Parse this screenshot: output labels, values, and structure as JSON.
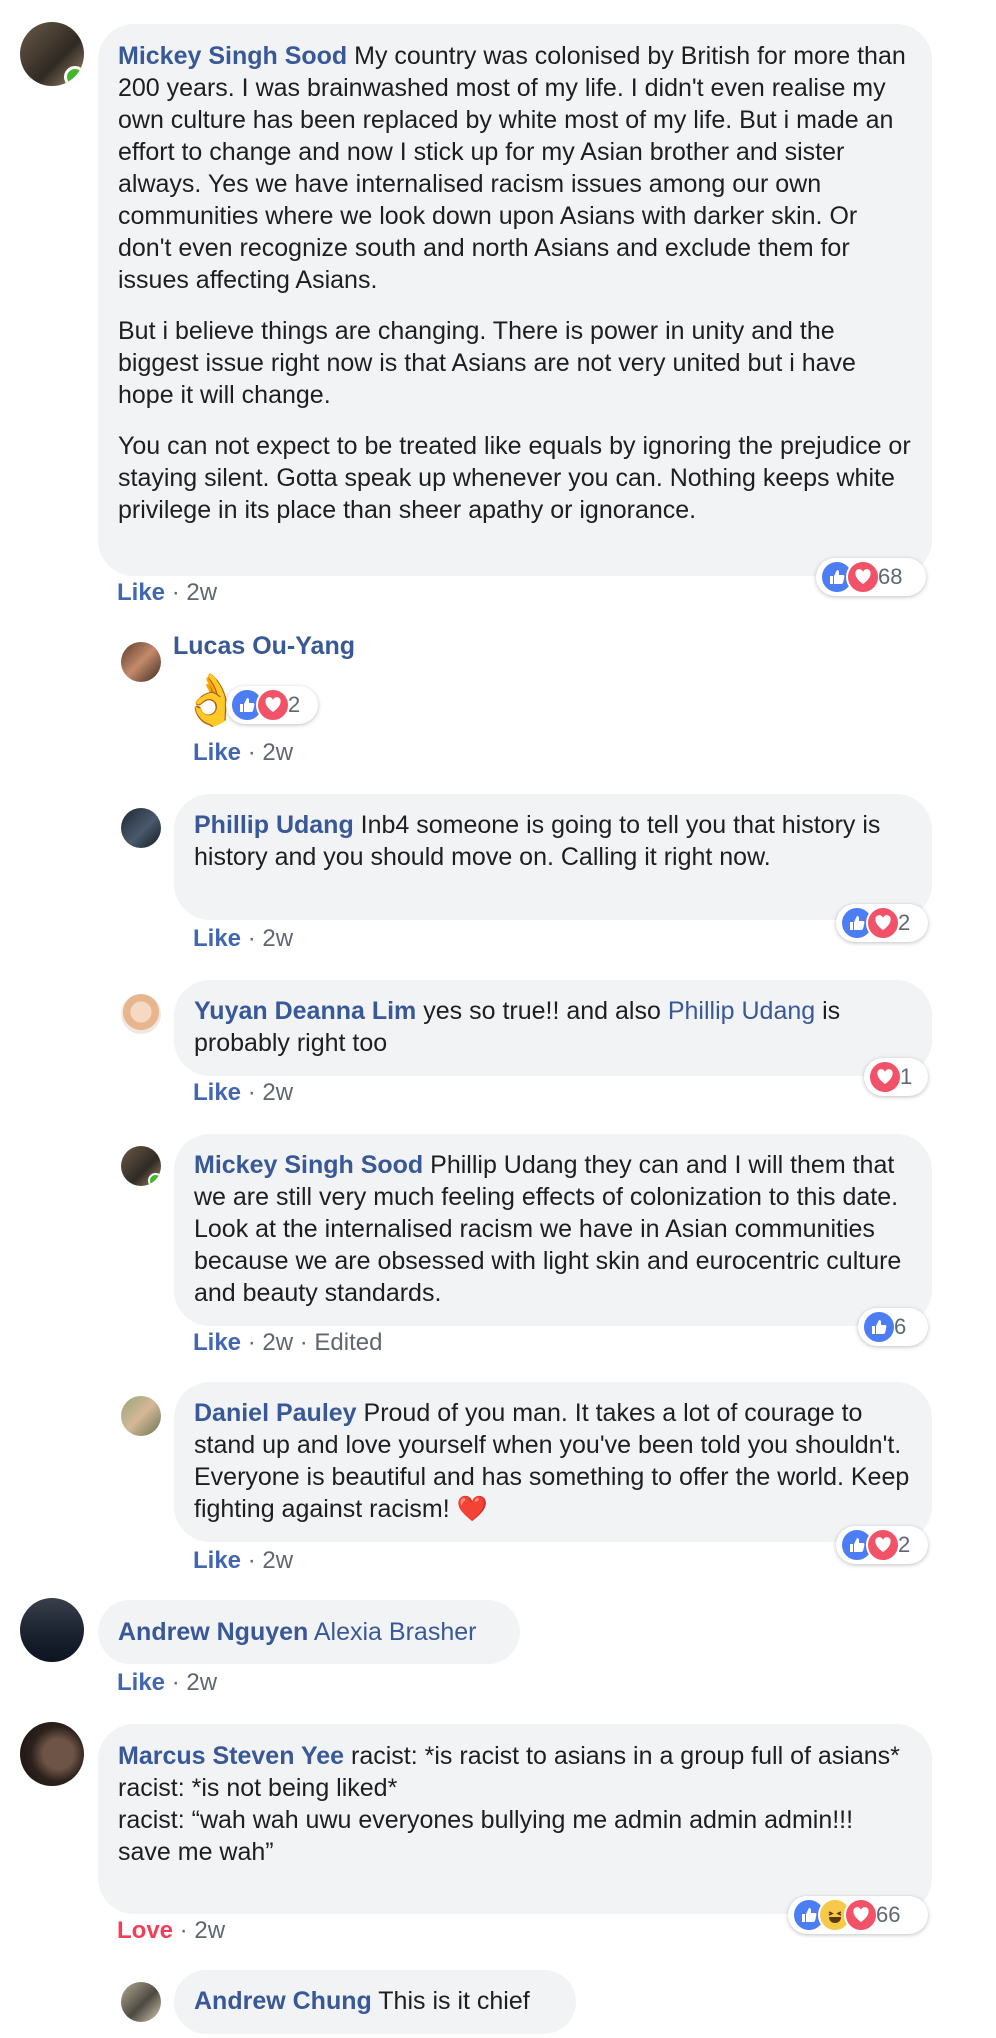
{
  "comments": [
    {
      "author": "Mickey Singh Sood",
      "paragraphs": [
        "My country was colonised by British for more than 200 years. I was brainwashed most of my life. I didn't even realise my own culture has been replaced by white most of my life. But i made an effort to change and now I stick up for my Asian brother and sister always. Yes we have internalised racism issues among our own communities where we look down upon Asians with darker skin. Or don't even recognize south and north Asians and exclude them for issues affecting Asians.",
        "But i believe things are changing. There is power in unity and the biggest issue right now is that Asians are not very united but i have hope it will change.",
        "You can not expect to be treated like equals by ignoring the prejudice or staying silent. Gotta speak up whenever you can. Nothing keeps white privilege in its place than sheer apathy or ignorance."
      ],
      "action": "Like",
      "time": "2w",
      "reaction_count": "68"
    },
    {
      "author": "Lucas Ou-Yang",
      "emoji": "👌",
      "action": "Like",
      "time": "2w",
      "reaction_count": "2"
    },
    {
      "author": "Phillip Udang",
      "text": "Inb4 someone is going to tell you that history is history and you should move on. Calling it right now.",
      "action": "Like",
      "time": "2w",
      "reaction_count": "2"
    },
    {
      "author": "Yuyan Deanna Lim",
      "text_before": "yes so true!! and also",
      "mention": "Phillip Udang",
      "text_after": "is probably right too",
      "action": "Like",
      "time": "2w",
      "reaction_count": "1"
    },
    {
      "author": "Mickey Singh Sood",
      "text": "Phillip Udang they can and I will them that we are still very much feeling effects of colonization to this date. Look at the internalised racism we have in Asian communities because we are obsessed with light skin and eurocentric culture and beauty standards.",
      "action": "Like",
      "time": "2w",
      "edited": "Edited",
      "reaction_count": "6"
    },
    {
      "author": "Daniel Pauley",
      "text": "Proud of you man. It takes a lot of courage to stand up and love yourself when you've been told you shouldn't. Everyone is beautiful and has something to offer the world. Keep fighting against racism!",
      "emoji": "❤️",
      "action": "Like",
      "time": "2w",
      "reaction_count": "2"
    },
    {
      "author": "Andrew Nguyen",
      "mention": "Alexia Brasher",
      "action": "Like",
      "time": "2w"
    },
    {
      "author": "Marcus Steven Yee",
      "lines": [
        "racist: *is racist to asians in a group full of asians*",
        "racist: *is not being liked*",
        "racist: “wah wah uwu everyones bullying me admin admin admin!!! save me wah”"
      ],
      "action": "Love",
      "time": "2w",
      "reaction_count": "66"
    },
    {
      "author": "Andrew Chung",
      "text": "This is it chief"
    }
  ],
  "separator": " · ",
  "colors": {
    "link": "#385898",
    "like": "#4267b2",
    "love": "#f33e58",
    "bubble": "#f2f3f5",
    "online": "#42b72a"
  }
}
